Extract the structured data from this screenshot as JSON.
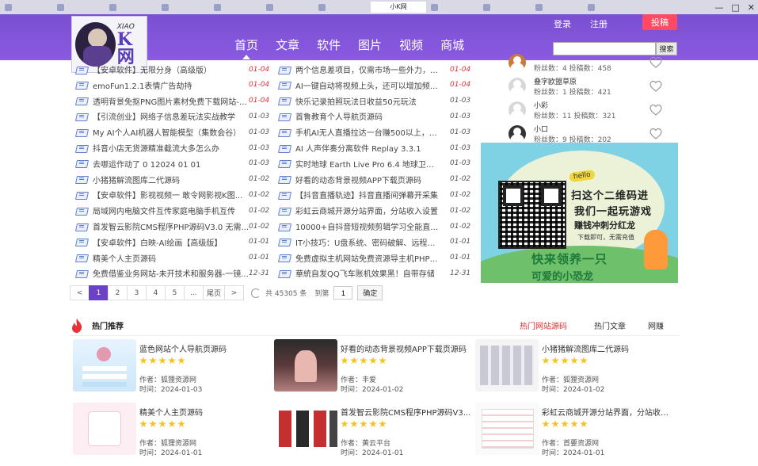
{
  "browser": {
    "active_tab": "小K网",
    "window_controls": [
      "—",
      "□",
      "✕"
    ]
  },
  "header": {
    "logo_small": "XIAO",
    "logo_big": "K网",
    "nav": [
      "首页",
      "文章",
      "软件",
      "图片",
      "视频",
      "商城"
    ],
    "login": "登录",
    "register": "注册",
    "contribute": "投稿",
    "search_button": "搜索",
    "search_placeholder": ""
  },
  "articles": {
    "left": [
      {
        "title": "【安卓软件】无限分身（高级版）",
        "date": "01-04",
        "new": true
      },
      {
        "title": "emoFun1.2.1表情广告劫持",
        "date": "01-04",
        "new": true
      },
      {
        "title": "透明背景免抠PNG图片素材免费下载网站-P...",
        "date": "01-04",
        "new": true
      },
      {
        "title": "【引流创业】网络子信息差玩法实战教学",
        "date": "01-03",
        "new": false
      },
      {
        "title": "My AI个人AI机器人智能模型（集数会谷）",
        "date": "01-03",
        "new": false
      },
      {
        "title": "抖音小店无货源精准截流大多怎么办",
        "date": "01-03",
        "new": false
      },
      {
        "title": "去哪运作动了 0 12024 01 01",
        "date": "01-03",
        "new": false
      },
      {
        "title": "小猪猪解流图库二代源码",
        "date": "01-02",
        "new": false
      },
      {
        "title": "【安卓软件】影视视频一 敢令网影视K图...",
        "date": "01-02",
        "new": false
      },
      {
        "title": "局域网内电脑文件互传家庭电脑手机互传",
        "date": "01-02",
        "new": false
      },
      {
        "title": "首发智云影院CMS程序PHP源码V3.0 无需...",
        "date": "01-02",
        "new": false
      },
      {
        "title": "【安卓软件】白映-AI绘画【高级版】",
        "date": "01-01",
        "new": false
      },
      {
        "title": "精美个人主页源码",
        "date": "01-01",
        "new": false
      },
      {
        "title": "免费借鉴业务网站-未开技术和服务器-一镜...",
        "date": "12-31",
        "new": false
      }
    ],
    "right": [
      {
        "title": "两个信息差项目，仅需市场一些外力，就可",
        "date": "01-04",
        "new": true
      },
      {
        "title": "AI一键自动将视频上头，还可以增加频段！",
        "date": "01-04",
        "new": true
      },
      {
        "title": "快乐记录拍照玩法日收益50元玩法",
        "date": "01-03",
        "new": false
      },
      {
        "title": "首鲁教育个人导航页源码",
        "date": "01-03",
        "new": false
      },
      {
        "title": "手机AI无人直播拉达一台赚500以上，全网...",
        "date": "01-03",
        "new": false
      },
      {
        "title": "AI 人声伴奏分离软件 Replay 3.3.1",
        "date": "01-03",
        "new": false
      },
      {
        "title": "实时地球 Earth Live Pro 6.4 地球卫星观测",
        "date": "01-03",
        "new": false
      },
      {
        "title": "好看的动态背景视频APP下载页源码",
        "date": "01-02",
        "new": false
      },
      {
        "title": "【抖音直播轨迹】抖音直播间弹幕开采集",
        "date": "01-02",
        "new": false
      },
      {
        "title": "彩虹云商城开源分站界面，分站收入设置",
        "date": "01-02",
        "new": false
      },
      {
        "title": "10000+自抖音短视频剪辑学习全能直播效果...",
        "date": "01-02",
        "new": false
      },
      {
        "title": "IT小技巧：U盘系统、密码破解、远程连...",
        "date": "01-01",
        "new": false
      },
      {
        "title": "免费虚拟主机网站免费资源导主机PHP空间",
        "date": "01-01",
        "new": false
      },
      {
        "title": "華統自发QQ飞车账机效果黑！自带存储",
        "date": "12-31",
        "new": false
      }
    ]
  },
  "pagination": {
    "prev": "<",
    "pages": [
      "1",
      "2",
      "3",
      "4",
      "5"
    ],
    "ellipsis": "...",
    "last": "尾页",
    "next": ">",
    "total": "共 45305 条",
    "goto_label": "到第",
    "goto_value": "1",
    "confirm": "确定",
    "current": 1
  },
  "users": [
    {
      "name": "",
      "stats": "粉丝数：4 投稿数：458"
    },
    {
      "name": "叠字欧盟草原",
      "stats": "粉丝数：1 投稿数：421"
    },
    {
      "name": "小彩",
      "stats": "粉丝数：11 投稿数：321"
    },
    {
      "name": "小口",
      "stats": "粉丝数：9 投稿数：202"
    }
  ],
  "banner": {
    "hello": "hello",
    "line1": "扫这个二维码进",
    "line2": "我们一起玩游戏",
    "line3": "赚钱冲刺分红龙",
    "line4": "下载即可，无需充值",
    "line5": "快来领养一只",
    "line6": "可爱的小恐龙"
  },
  "hot": {
    "title": "热门推荐",
    "tabs": [
      "热门网站源码",
      "热门文章",
      "网赚"
    ],
    "active_tab": 0,
    "cards": [
      {
        "title": "蓝色网站个人导航页源码",
        "author": "作者：狐狸资源网",
        "time": "时间：2024-01-03",
        "stars": 5
      },
      {
        "title": "好看的动态背景视频APP下载页源码",
        "author": "作者：丰爱",
        "time": "时间：2024-01-02",
        "stars": 5
      },
      {
        "title": "小猪猪解流图库二代源码",
        "author": "作者：狐狸资源网",
        "time": "时间：2024-01-02",
        "stars": 5
      },
      {
        "title": "精美个人主页源码",
        "author": "作者：狐狸资源网",
        "time": "时间：2024-01-01",
        "stars": 5
      },
      {
        "title": "首发智云影院CMS程序PHP源码V3...",
        "author": "作者：黄云平台",
        "time": "时间：2024-01-01",
        "stars": 5
      },
      {
        "title": "彩虹云商城开源分站界面，分站收入...",
        "author": "作者：首要资源网",
        "time": "时间：2024-01-01",
        "stars": 5
      }
    ]
  },
  "colors": {
    "header": "#7a4fd1",
    "accent": "#6a42c8",
    "new_date": "#e0303a",
    "contribute": "#ff4a64",
    "star": "#f5c21b"
  }
}
